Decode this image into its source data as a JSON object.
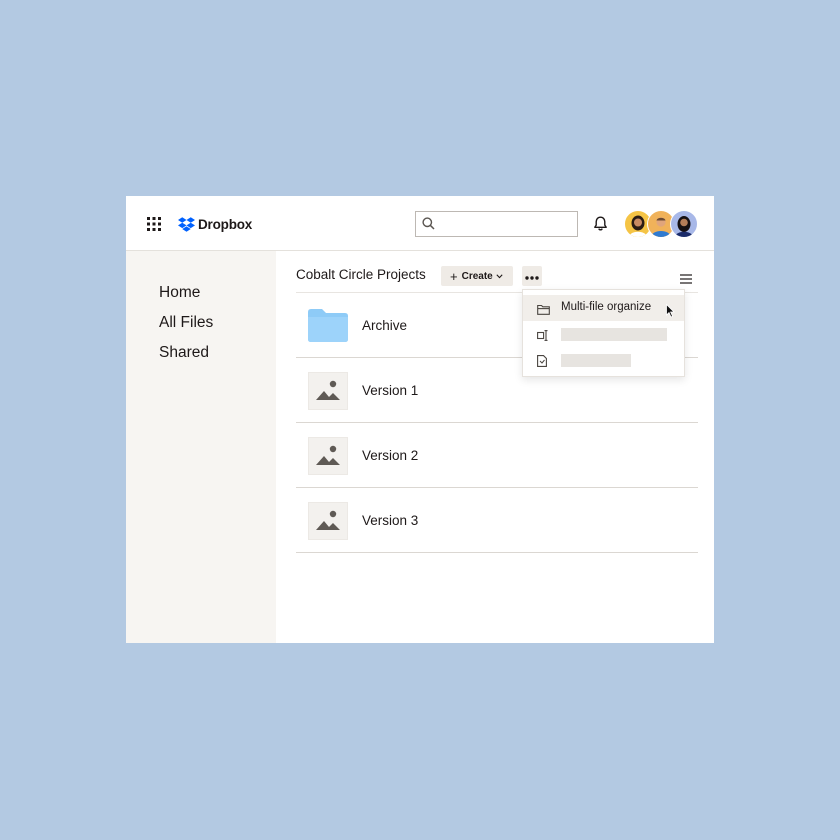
{
  "app": {
    "brand": "Dropbox",
    "colors": {
      "background": "#b3c9e2",
      "brand_blue": "#0061fe",
      "sidebar": "#f7f5f2",
      "folder": "#8ecbf7"
    }
  },
  "header": {
    "search": {
      "placeholder": "",
      "value": ""
    },
    "icons": [
      "apps-grid-icon",
      "dropbox-logo-icon",
      "search-icon",
      "bell-icon"
    ],
    "avatars": [
      "avatar-1",
      "avatar-2",
      "avatar-3"
    ]
  },
  "sidebar": {
    "items": [
      {
        "label": "Home"
      },
      {
        "label": "All Files"
      },
      {
        "label": "Shared"
      }
    ]
  },
  "toolbar": {
    "breadcrumb": "Cobalt Circle Projects",
    "create_label": "Create",
    "icons": [
      "plus-icon",
      "chevron-down-icon",
      "more-options-icon",
      "list-view-icon"
    ]
  },
  "files": [
    {
      "name": "Archive",
      "icon": "folder-icon"
    },
    {
      "name": "Version 1",
      "icon": "image-icon"
    },
    {
      "name": "Version 2",
      "icon": "image-icon"
    },
    {
      "name": "Version 3",
      "icon": "image-icon"
    }
  ],
  "context_menu": {
    "items": [
      {
        "label": "Multi-file organize",
        "icon": "folder-outline-icon"
      },
      {
        "label": "",
        "icon": "rename-icon"
      },
      {
        "label": "",
        "icon": "document-icon"
      }
    ]
  }
}
